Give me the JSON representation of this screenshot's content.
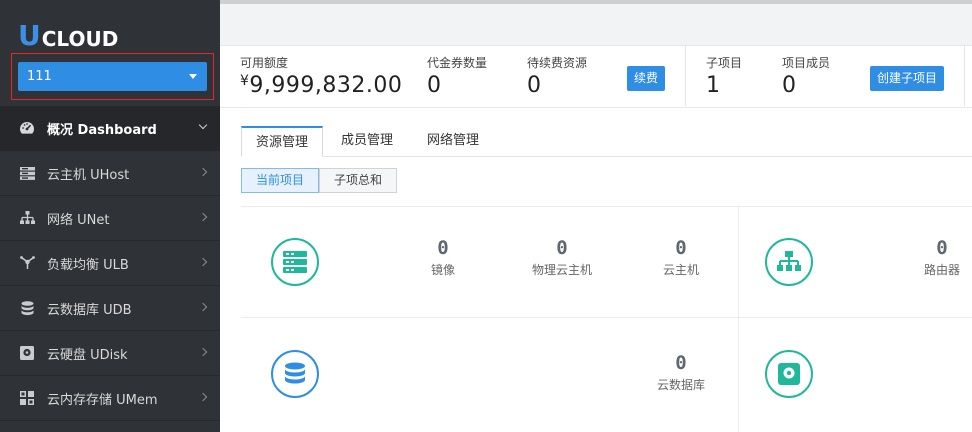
{
  "brand": {
    "logo_letter": "U",
    "logo_rest": "CLOUD"
  },
  "project_selector": {
    "value": "111"
  },
  "nav": [
    {
      "label": "概况 Dashboard",
      "icon": "dashboard-icon",
      "active": true
    },
    {
      "label": "云主机 UHost",
      "icon": "server-icon"
    },
    {
      "label": "网络 UNet",
      "icon": "network-icon"
    },
    {
      "label": "负载均衡 ULB",
      "icon": "load-balancer-icon"
    },
    {
      "label": "云数据库 UDB",
      "icon": "database-icon"
    },
    {
      "label": "云硬盘 UDisk",
      "icon": "disk-icon"
    },
    {
      "label": "云内存存储 UMem",
      "icon": "memory-icon"
    }
  ],
  "stats": {
    "quota_label": "可用额度",
    "quota_currency": "¥",
    "quota_value": "9,999,832.00",
    "voucher_label": "代金券数量",
    "voucher_value": "0",
    "renew_label": "待续费资源",
    "renew_value": "0",
    "renew_button": "续费",
    "subproject_label": "子项目",
    "subproject_value": "1",
    "member_label": "项目成员",
    "member_value": "0",
    "create_sub_button": "创建子项目"
  },
  "tabs": [
    "资源管理",
    "成员管理",
    "网络管理"
  ],
  "subtabs": [
    "当前项目",
    "子项总和"
  ],
  "resources": {
    "compute": {
      "icon": "server-rack-icon",
      "metrics": [
        {
          "value": "0",
          "label": "镜像"
        },
        {
          "value": "0",
          "label": "物理云主机"
        },
        {
          "value": "0",
          "label": "云主机"
        }
      ]
    },
    "network": {
      "icon": "network-tree-icon",
      "metrics": [
        {
          "value": "0",
          "label": "路由器"
        }
      ]
    },
    "database": {
      "icon": "database-stack-icon",
      "metrics": [
        {
          "value": "0",
          "label": "云数据库"
        }
      ]
    },
    "disk": {
      "icon": "disk-square-icon"
    }
  },
  "colors": {
    "accent": "#2f8de4",
    "teal": "#1fb89a",
    "sidebar": "#2f3236",
    "alert_border": "#e02a2a"
  }
}
